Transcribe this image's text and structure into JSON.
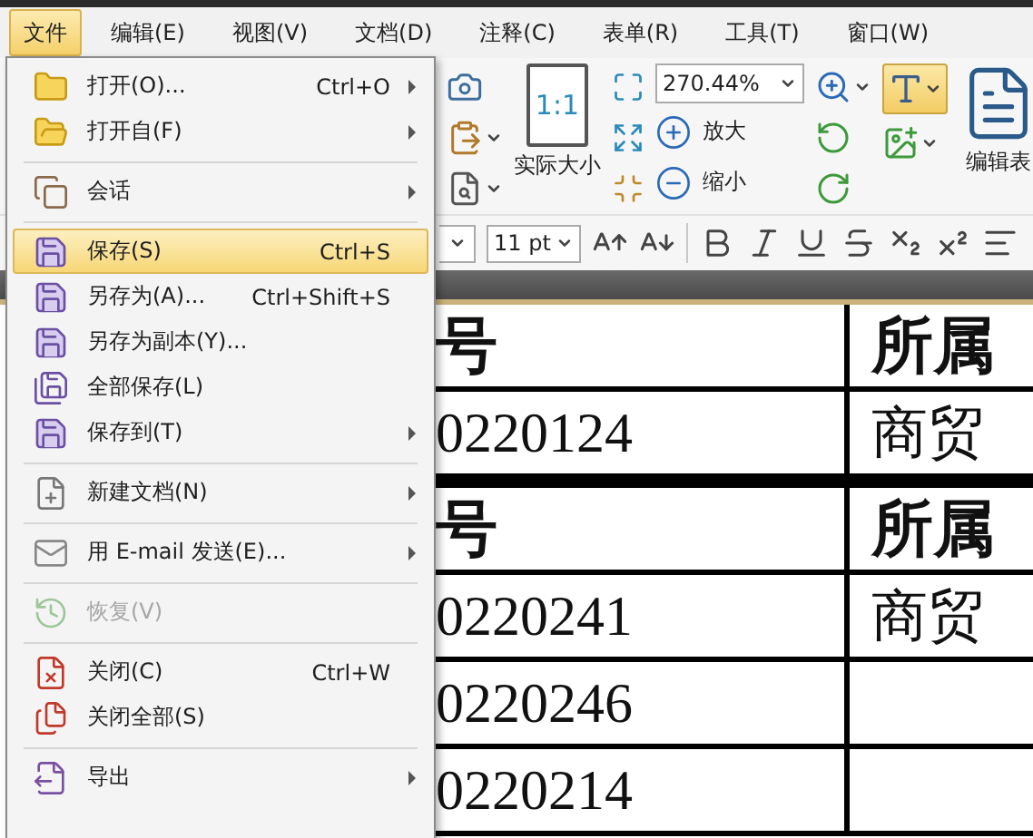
{
  "menubar": {
    "items": [
      {
        "label": "文件",
        "selected": true
      },
      {
        "label": "编辑(E)",
        "selected": false
      },
      {
        "label": "视图(V)",
        "selected": false
      },
      {
        "label": "文档(D)",
        "selected": false
      },
      {
        "label": "注释(C)",
        "selected": false
      },
      {
        "label": "表单(R)",
        "selected": false
      },
      {
        "label": "工具(T)",
        "selected": false
      },
      {
        "label": "窗口(W)",
        "selected": false
      }
    ]
  },
  "file_menu": {
    "items": [
      {
        "kind": "item",
        "label": "打开(O)...",
        "shortcut": "Ctrl+O",
        "submenu": true,
        "selected": false,
        "disabled": false
      },
      {
        "kind": "item",
        "label": "打开自(F)",
        "submenu": true,
        "selected": false,
        "disabled": false
      },
      {
        "kind": "separator"
      },
      {
        "kind": "item",
        "label": "会话",
        "submenu": true,
        "selected": false,
        "disabled": false
      },
      {
        "kind": "separator"
      },
      {
        "kind": "item",
        "label": "保存(S)",
        "shortcut": "Ctrl+S",
        "submenu": false,
        "selected": true,
        "disabled": false
      },
      {
        "kind": "item",
        "label": "另存为(A)...",
        "shortcut": "Ctrl+Shift+S",
        "submenu": false,
        "selected": false,
        "disabled": false
      },
      {
        "kind": "item",
        "label": "另存为副本(Y)...",
        "submenu": false,
        "selected": false,
        "disabled": false
      },
      {
        "kind": "item",
        "label": "全部保存(L)",
        "submenu": false,
        "selected": false,
        "disabled": false
      },
      {
        "kind": "item",
        "label": "保存到(T)",
        "submenu": true,
        "selected": false,
        "disabled": false
      },
      {
        "kind": "separator"
      },
      {
        "kind": "item",
        "label": "新建文档(N)",
        "submenu": true,
        "selected": false,
        "disabled": false
      },
      {
        "kind": "separator"
      },
      {
        "kind": "item",
        "label": "用 E-mail 发送(E)...",
        "submenu": true,
        "selected": false,
        "disabled": false
      },
      {
        "kind": "separator"
      },
      {
        "kind": "item",
        "label": "恢复(V)",
        "submenu": false,
        "selected": false,
        "disabled": true
      },
      {
        "kind": "separator"
      },
      {
        "kind": "item",
        "label": "关闭(C)",
        "shortcut": "Ctrl+W",
        "submenu": false,
        "selected": false,
        "disabled": false
      },
      {
        "kind": "item",
        "label": "关闭全部(S)",
        "submenu": false,
        "selected": false,
        "disabled": false
      },
      {
        "kind": "separator"
      },
      {
        "kind": "item",
        "label": "导出",
        "submenu": true,
        "selected": false,
        "disabled": false
      }
    ]
  },
  "ribbon": {
    "actual_size_icon_text": "1:1",
    "actual_size_label": "实际大小",
    "zoom_value": "270.44%",
    "zoom_in_label": "放大",
    "zoom_out_label": "缩小",
    "edit_form_label": "编辑表",
    "typewriter_selected": true
  },
  "format_bar": {
    "font_size": "11 pt"
  },
  "document": {
    "tables": [
      {
        "rows": [
          {
            "kind": "header",
            "cells": [
              "号",
              "所属"
            ]
          },
          {
            "kind": "data",
            "cells": [
              "0220124",
              "商贸"
            ]
          }
        ]
      },
      {
        "rows": [
          {
            "kind": "header",
            "cells": [
              "号",
              "所属"
            ]
          },
          {
            "kind": "data",
            "cells": [
              "0220241",
              "商贸"
            ]
          },
          {
            "kind": "data",
            "cells": [
              "0220246"
            ]
          },
          {
            "kind": "data",
            "cells": [
              "0220214"
            ]
          }
        ]
      }
    ]
  }
}
